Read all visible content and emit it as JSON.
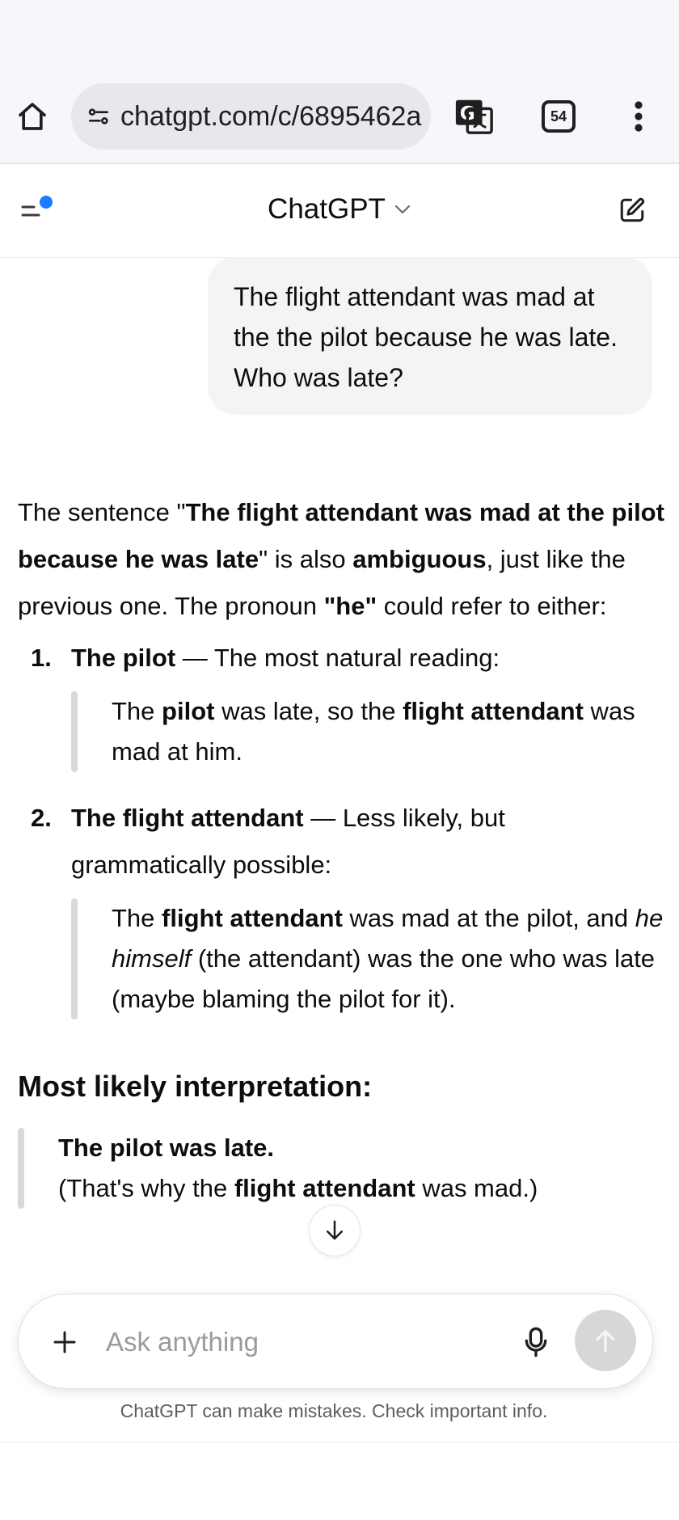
{
  "browser": {
    "url": "chatgpt.com/c/6895462a",
    "tab_count": "54",
    "icons": [
      "home-icon",
      "site-settings-icon",
      "translate-icon",
      "tabs-icon",
      "more-vert-icon"
    ]
  },
  "app": {
    "title": "ChatGPT",
    "icons": [
      "sidebar-icon",
      "chevron-down-icon",
      "new-chat-icon"
    ],
    "notification_dot_color": "#1a7cff"
  },
  "user_message": "The flight attendant was mad at the the pilot because he was late. Who was late?",
  "assistant": {
    "p1": {
      "a": "The sentence \"",
      "b": "The flight attendant was mad at the pilot because he was late",
      "c": "\" is also ",
      "d": "ambiguous",
      "e": ", just like the previous one. The pronoun ",
      "f": "\"he\"",
      "g": " could refer to either:"
    },
    "items": [
      {
        "num": "1.",
        "head": "The pilot",
        "rest": " — The most natural reading:",
        "quote": {
          "a": "The ",
          "b": "pilot",
          "c": " was late, so the ",
          "d": "flight attendant",
          "e": " was mad at him."
        }
      },
      {
        "num": "2.",
        "head": "The flight attendant",
        "rest": " — Less likely, but grammatically possible:",
        "quote": {
          "a": "The ",
          "b": "flight attendant",
          "c": " was mad at the pilot, and ",
          "d": "he himself",
          "e": " (the attendant) was the one who was late (maybe blaming the pilot for it)."
        }
      }
    ],
    "heading": "Most likely interpretation:",
    "conclusion": {
      "line1": "The pilot was late.",
      "a": "(That's why the ",
      "b": "flight attendant",
      "c": " was mad.)"
    }
  },
  "composer": {
    "placeholder": "Ask anything",
    "icons": [
      "plus-icon",
      "microphone-icon",
      "send-arrow-icon",
      "scroll-down-arrow-icon"
    ]
  },
  "disclaimer": "ChatGPT can make mistakes. Check important info."
}
